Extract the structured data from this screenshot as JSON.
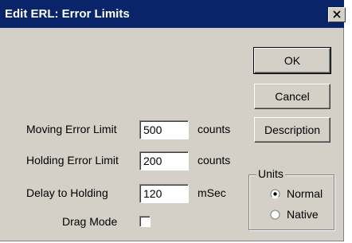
{
  "window": {
    "title": "Edit ERL:  Error Limits"
  },
  "buttons": {
    "ok": "OK",
    "cancel": "Cancel",
    "description": "Description"
  },
  "fields": [
    {
      "label": "Moving Error Limit",
      "value": "500",
      "unit": "counts"
    },
    {
      "label": "Holding Error Limit",
      "value": "200",
      "unit": "counts"
    },
    {
      "label": "Delay to Holding",
      "value": "120",
      "unit": "mSec"
    }
  ],
  "drag_mode": {
    "label": "Drag Mode",
    "checked": false
  },
  "units": {
    "legend": "Units",
    "options": [
      {
        "label": "Normal",
        "selected": true
      },
      {
        "label": "Native",
        "selected": false
      }
    ]
  },
  "colors": {
    "title_bar": "#0a246a",
    "dialog_face": "#d4d0c8"
  },
  "icons": {
    "close": "close-icon"
  }
}
